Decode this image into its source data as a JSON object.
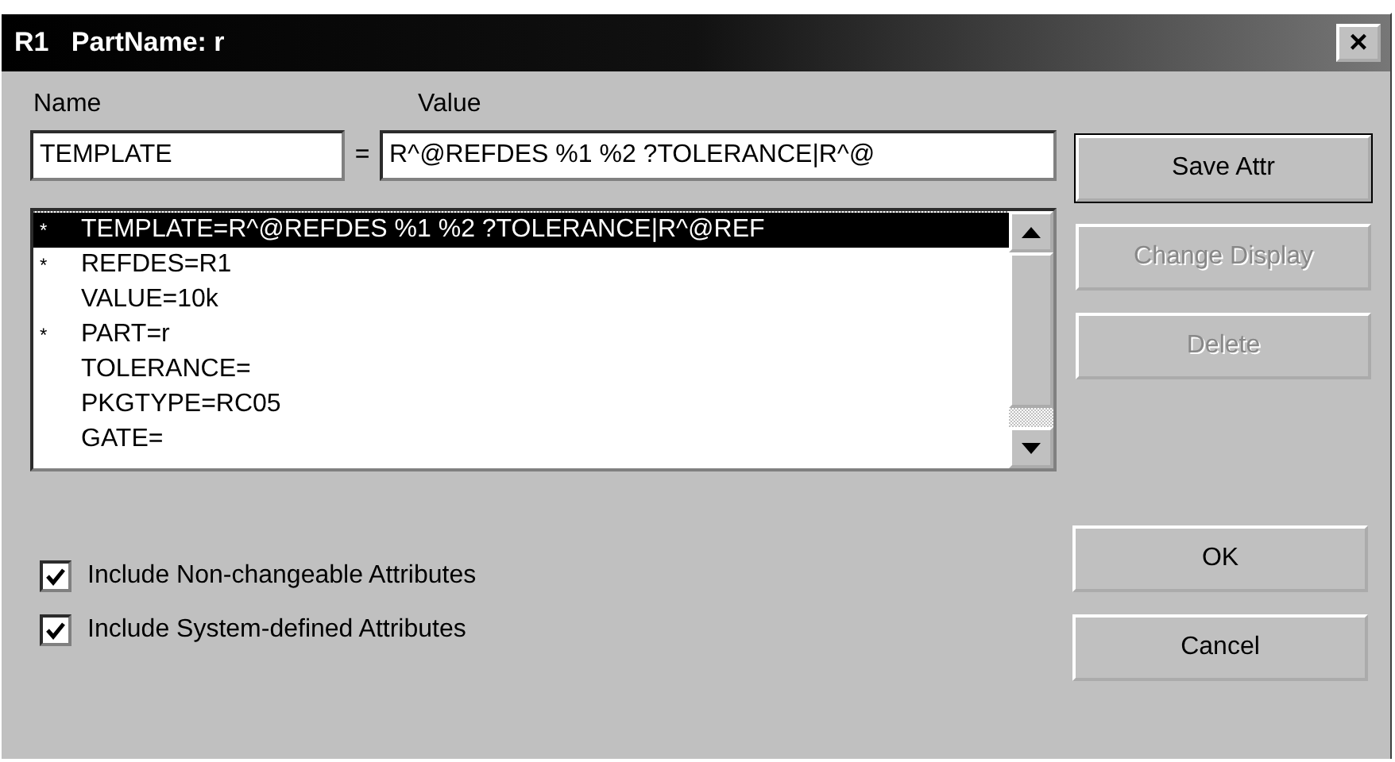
{
  "window": {
    "title": "R1   PartName: r",
    "close": "×"
  },
  "name_label": "Name",
  "value_label": "Value",
  "name_field": {
    "value": "TEMPLATE"
  },
  "equals": "=",
  "value_field": {
    "value": "R^@REFDES %1 %2 ?TOLERANCE|R^@"
  },
  "attributes": [
    {
      "text": "TEMPLATE=R^@REFDES %1 %2 ?TOLERANCE|R^@REF",
      "marked": true,
      "selected": true
    },
    {
      "text": "REFDES=R1",
      "marked": true,
      "selected": false
    },
    {
      "text": "VALUE=10k",
      "marked": false,
      "selected": false
    },
    {
      "text": "PART=r",
      "marked": true,
      "selected": false
    },
    {
      "text": "TOLERANCE=",
      "marked": false,
      "selected": false
    },
    {
      "text": "PKGTYPE=RC05",
      "marked": false,
      "selected": false
    },
    {
      "text": "GATE=",
      "marked": false,
      "selected": false
    }
  ],
  "mark_symbol": "*",
  "side_buttons": [
    {
      "label": "Save Attr",
      "disabled": false,
      "default": true
    },
    {
      "label": "Change Display",
      "disabled": true,
      "default": false
    },
    {
      "label": "Delete",
      "disabled": true,
      "default": false
    }
  ],
  "options": [
    {
      "label": "Include Non-changeable Attributes",
      "checked": true
    },
    {
      "label": "Include System-defined Attributes",
      "checked": true
    }
  ],
  "bottom_buttons": [
    {
      "label": "OK"
    },
    {
      "label": "Cancel"
    }
  ]
}
